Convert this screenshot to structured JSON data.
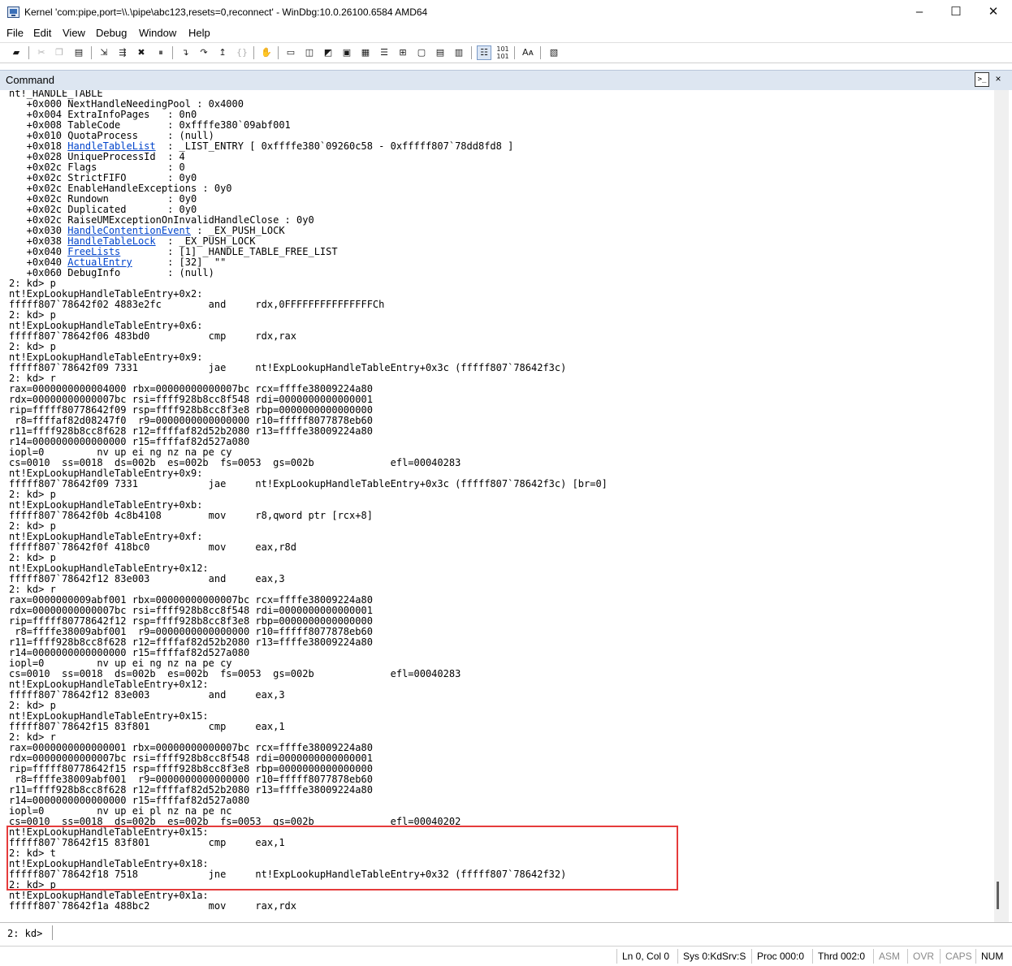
{
  "window": {
    "title": "Kernel 'com:pipe,port=\\\\.\\pipe\\abc123,resets=0,reconnect' - WinDbg:10.0.26100.6584 AMD64",
    "minimize_glyph": "–",
    "maximize_glyph": "☐",
    "close_glyph": "✕"
  },
  "menu": [
    "File",
    "Edit",
    "View",
    "Debug",
    "Window",
    "Help"
  ],
  "toolbar_icons": [
    "open-icon",
    "cut-icon",
    "copy-icon",
    "paste-icon",
    "go-icon",
    "restart-icon",
    "stop-debugging-icon",
    "break-icon",
    "step-into-icon",
    "step-over-icon",
    "step-out-icon",
    "run-to-cursor-icon",
    "insert-breakpoint-icon",
    "command-window-icon",
    "watch-window-icon",
    "locals-window-icon",
    "registers-window-icon",
    "memory-window-icon",
    "call-stack-window-icon",
    "disassembly-window-icon",
    "scratch-pad-icon",
    "processes-threads-icon",
    "source-mode-icon",
    "hex-mode-icon",
    "font-icon",
    "options-icon"
  ],
  "panel": {
    "title": "Command",
    "close_glyph": "×"
  },
  "output_lines": [
    "nt!_HANDLE_TABLE",
    "   +0x000 NextHandleNeedingPool : 0x4000",
    "   +0x004 ExtraInfoPages   : 0n0",
    "   +0x008 TableCode        : 0xffffe380`09abf001",
    "   +0x010 QuotaProcess     : (null)",
    "   +0x018 HandleTableList  : _LIST_ENTRY [ 0xffffe380`09260c58 - 0xfffff807`78dd8fd8 ]",
    "   +0x028 UniqueProcessId  : 4",
    "   +0x02c Flags            : 0",
    "   +0x02c StrictFIFO       : 0y0",
    "   +0x02c EnableHandleExceptions : 0y0",
    "   +0x02c Rundown          : 0y0",
    "   +0x02c Duplicated       : 0y0",
    "   +0x02c RaiseUMExceptionOnInvalidHandleClose : 0y0",
    "   +0x030 HandleContentionEvent : _EX_PUSH_LOCK",
    "   +0x038 HandleTableLock  : _EX_PUSH_LOCK",
    "   +0x040 FreeLists        : [1] _HANDLE_TABLE_FREE_LIST",
    "   +0x040 ActualEntry      : [32]  \"\"",
    "   +0x060 DebugInfo        : (null)",
    "2: kd> p",
    "nt!ExpLookupHandleTableEntry+0x2:",
    "fffff807`78642f02 4883e2fc        and     rdx,0FFFFFFFFFFFFFFFCh",
    "2: kd> p",
    "nt!ExpLookupHandleTableEntry+0x6:",
    "fffff807`78642f06 483bd0          cmp     rdx,rax",
    "2: kd> p",
    "nt!ExpLookupHandleTableEntry+0x9:",
    "fffff807`78642f09 7331            jae     nt!ExpLookupHandleTableEntry+0x3c (fffff807`78642f3c)",
    "2: kd> r",
    "rax=0000000000004000 rbx=00000000000007bc rcx=ffffe38009224a80",
    "rdx=00000000000007bc rsi=ffff928b8cc8f548 rdi=0000000000000001",
    "rip=fffff80778642f09 rsp=ffff928b8cc8f3e8 rbp=0000000000000000",
    " r8=ffffaf82d08247f0  r9=0000000000000000 r10=fffff8077878eb60",
    "r11=ffff928b8cc8f628 r12=ffffaf82d52b2080 r13=ffffe38009224a80",
    "r14=0000000000000000 r15=ffffaf82d527a080",
    "iopl=0         nv up ei ng nz na pe cy",
    "cs=0010  ss=0018  ds=002b  es=002b  fs=0053  gs=002b             efl=00040283",
    "nt!ExpLookupHandleTableEntry+0x9:",
    "fffff807`78642f09 7331            jae     nt!ExpLookupHandleTableEntry+0x3c (fffff807`78642f3c) [br=0]",
    "2: kd> p",
    "nt!ExpLookupHandleTableEntry+0xb:",
    "fffff807`78642f0b 4c8b4108        mov     r8,qword ptr [rcx+8]",
    "2: kd> p",
    "nt!ExpLookupHandleTableEntry+0xf:",
    "fffff807`78642f0f 418bc0          mov     eax,r8d",
    "2: kd> p",
    "nt!ExpLookupHandleTableEntry+0x12:",
    "fffff807`78642f12 83e003          and     eax,3",
    "2: kd> r",
    "rax=0000000009abf001 rbx=00000000000007bc rcx=ffffe38009224a80",
    "rdx=00000000000007bc rsi=ffff928b8cc8f548 rdi=0000000000000001",
    "rip=fffff80778642f12 rsp=ffff928b8cc8f3e8 rbp=0000000000000000",
    " r8=ffffe38009abf001  r9=0000000000000000 r10=fffff8077878eb60",
    "r11=ffff928b8cc8f628 r12=ffffaf82d52b2080 r13=ffffe38009224a80",
    "r14=0000000000000000 r15=ffffaf82d527a080",
    "iopl=0         nv up ei ng nz na pe cy",
    "cs=0010  ss=0018  ds=002b  es=002b  fs=0053  gs=002b             efl=00040283",
    "nt!ExpLookupHandleTableEntry+0x12:",
    "fffff807`78642f12 83e003          and     eax,3",
    "2: kd> p",
    "nt!ExpLookupHandleTableEntry+0x15:",
    "fffff807`78642f15 83f801          cmp     eax,1",
    "2: kd> r",
    "rax=0000000000000001 rbx=00000000000007bc rcx=ffffe38009224a80",
    "rdx=00000000000007bc rsi=ffff928b8cc8f548 rdi=0000000000000001",
    "rip=fffff80778642f15 rsp=ffff928b8cc8f3e8 rbp=0000000000000000",
    " r8=ffffe38009abf001  r9=0000000000000000 r10=fffff8077878eb60",
    "r11=ffff928b8cc8f628 r12=ffffaf82d52b2080 r13=ffffe38009224a80",
    "r14=0000000000000000 r15=ffffaf82d527a080",
    "iopl=0         nv up ei pl nz na pe nc",
    "cs=0010  ss=0018  ds=002b  es=002b  fs=0053  gs=002b             efl=00040202",
    "nt!ExpLookupHandleTableEntry+0x15:",
    "fffff807`78642f15 83f801          cmp     eax,1",
    "2: kd> t",
    "nt!ExpLookupHandleTableEntry+0x18:",
    "fffff807`78642f18 7518            jne     nt!ExpLookupHandleTableEntry+0x32 (fffff807`78642f32)",
    "2: kd> p",
    "nt!ExpLookupHandleTableEntry+0x1a:",
    "fffff807`78642f1a 488bc2          mov     rax,rdx"
  ],
  "links": [
    "HandleTableList",
    "HandleContentionEvent",
    "HandleTableLock",
    "FreeLists",
    "ActualEntry"
  ],
  "highlight_color": "#e53b3b",
  "prompt": "2: kd>",
  "command_input_value": "",
  "status": {
    "position": "Ln 0, Col 0",
    "sys": "Sys 0:KdSrv:S",
    "proc": "Proc 000:0",
    "thrd": "Thrd 002:0",
    "asm": "ASM",
    "ovr": "OVR",
    "caps": "CAPS",
    "num": "NUM"
  }
}
